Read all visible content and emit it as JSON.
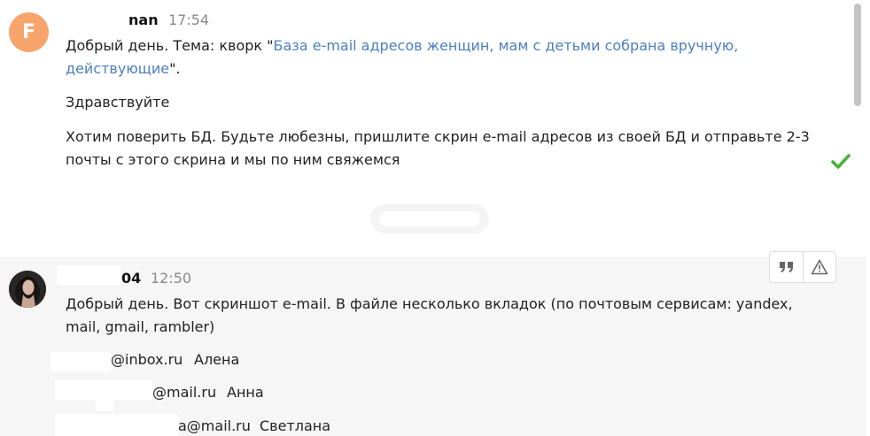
{
  "message1": {
    "avatar_letter": "F",
    "author": "nan",
    "time": "17:54",
    "text_prefix": "Добрый день. Тема: кворк \"",
    "link": "База e-mail адресов женщин, мам с детьми собрана вручную, действующие",
    "text_suffix": "\".",
    "greeting": "Здравствуйте",
    "body": "Хотим поверить БД. Будьте любезны, пришлите скрин e-mail адресов из своей БД и отправьте 2-3 почты с этого скрина и мы по ним свяжемся",
    "status_icon": "checkmark-icon",
    "accent_color": "#4a7fc1",
    "check_color": "#4caf3f"
  },
  "message2": {
    "author": "04",
    "time": "12:50",
    "text": "Добрый день. Вот скриншот e-mail. В файле несколько вкладок (по почтовым сервисам: yandex, mail, gmail, rambler)",
    "emails": [
      {
        "address": "@inbox.ru",
        "name": "Алена"
      },
      {
        "address": "@mail.ru",
        "name": "Анна"
      },
      {
        "address": "a@mail.ru",
        "name": "Светлана"
      }
    ],
    "actions": [
      {
        "icon": "quote-icon"
      },
      {
        "icon": "warning-icon"
      }
    ]
  }
}
